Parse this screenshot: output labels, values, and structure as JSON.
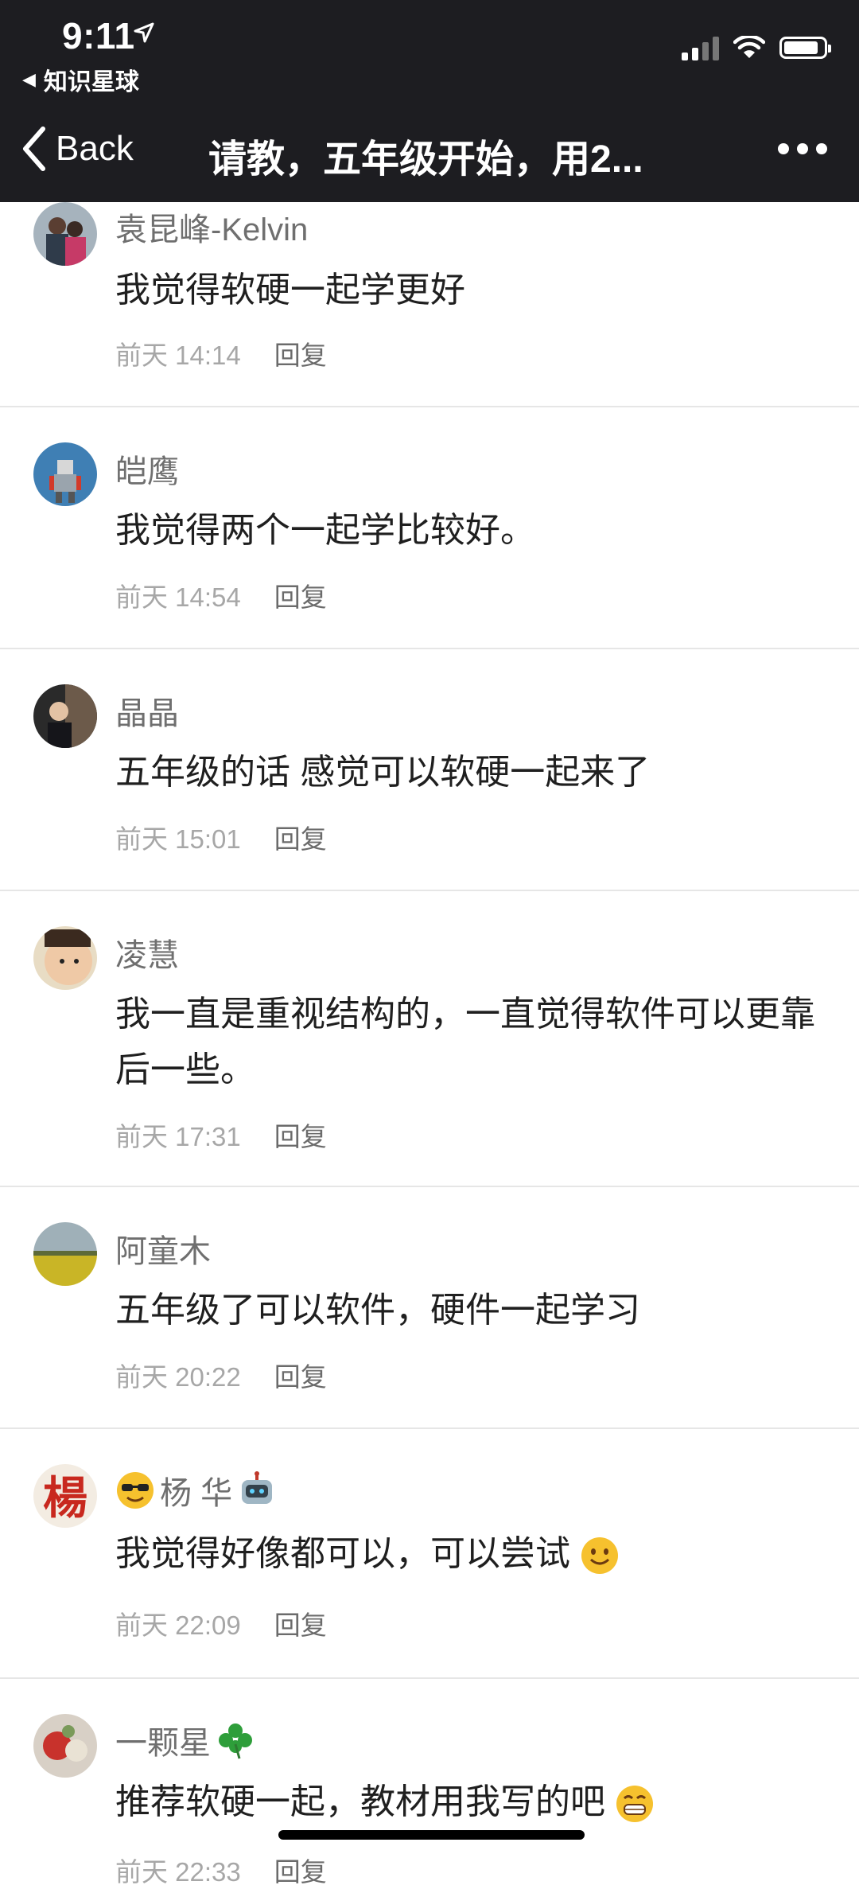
{
  "status": {
    "time": "9:11",
    "back_app": "知识星球"
  },
  "nav": {
    "back": "Back",
    "title": "请教，五年级开始，用2..."
  },
  "comments": [
    {
      "name": "袁昆峰-Kelvin",
      "text": "我觉得软硬一起学更好",
      "time": "前天 14:14",
      "reply": "回复"
    },
    {
      "name": "皑鹰",
      "text": "我觉得两个一起学比较好。",
      "time": "前天 14:54",
      "reply": "回复"
    },
    {
      "name": "晶晶",
      "text": "五年级的话 感觉可以软硬一起来了",
      "time": "前天 15:01",
      "reply": "回复"
    },
    {
      "name": "凌慧",
      "text": "我一直是重视结构的，一直觉得软件可以更靠后一些。",
      "time": "前天 17:31",
      "reply": "回复"
    },
    {
      "name": "阿童木",
      "text": "五年级了可以软件，硬件一起学习",
      "time": "前天 20:22",
      "reply": "回复"
    },
    {
      "name": "杨 华",
      "text": "我觉得好像都可以，可以尝试",
      "time": "前天 22:09",
      "reply": "回复"
    },
    {
      "name": "一颗星",
      "text": "推荐软硬一起，教材用我写的吧",
      "time": "前天 22:33",
      "reply": "回复"
    }
  ],
  "icons": [
    "location-arrow-icon",
    "signal-icon",
    "wifi-icon",
    "battery-icon",
    "back-chevron-icon",
    "more-dots-icon"
  ],
  "colors": {
    "nav_bg": "#1d1d21",
    "text": "#1f1f1f",
    "name": "#6f6f6f",
    "meta": "#a7a7a7"
  }
}
